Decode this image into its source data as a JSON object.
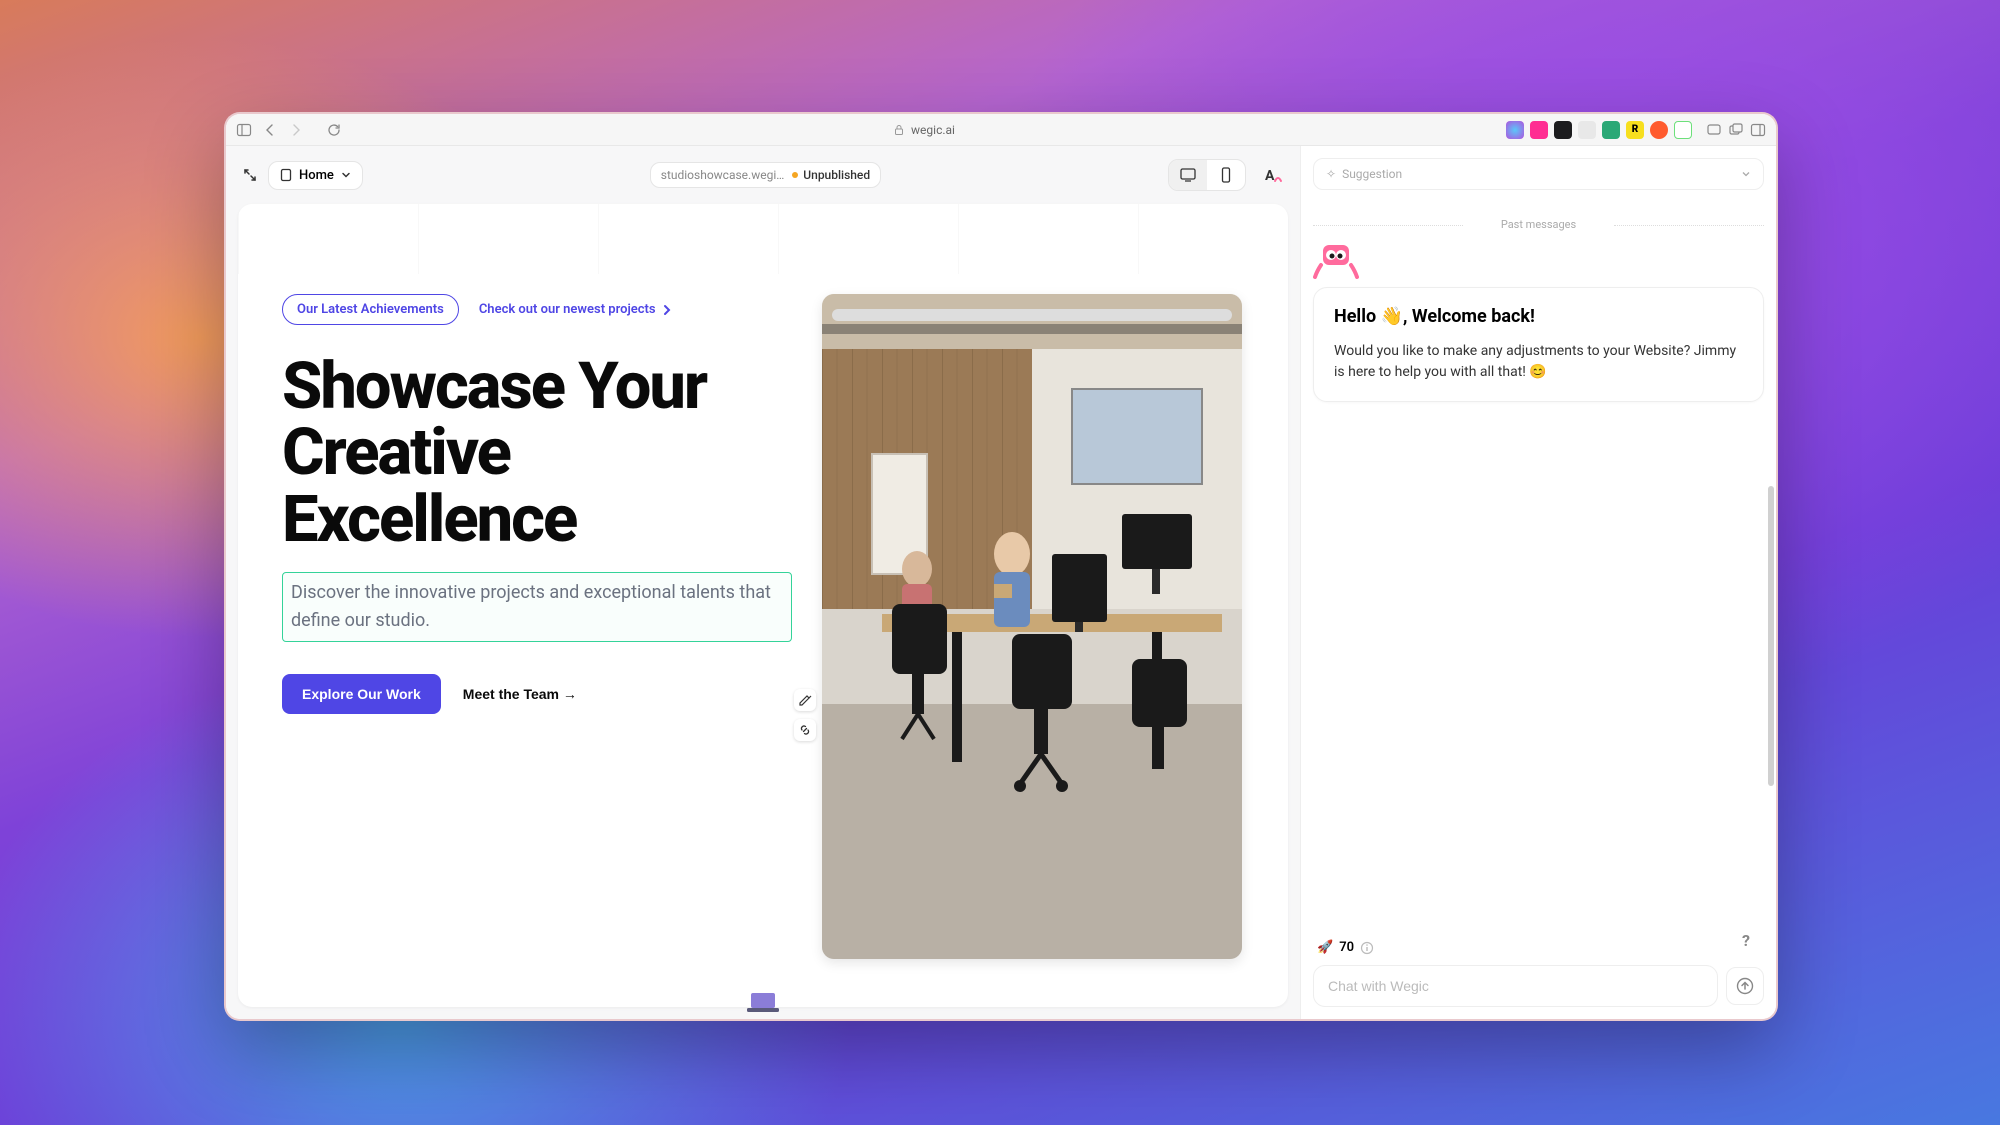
{
  "browser": {
    "url": "wegic.ai"
  },
  "editor": {
    "home_label": "Home",
    "project_url": "studioshowcase.wegi…",
    "status": "Unpublished"
  },
  "hero": {
    "badge": "Our Latest Achievements",
    "link": "Check out our newest projects",
    "title": "Showcase Your Creative Excellence",
    "description": "Discover the innovative projects and exceptional talents that define our studio.",
    "cta_primary": "Explore Our Work",
    "cta_secondary": "Meet the Team →"
  },
  "chat": {
    "suggestion_label": "Suggestion",
    "past_label": "Past messages",
    "greeting": "Hello 👋, Welcome back!",
    "body": "Would you like to make any adjustments to your Website? Jimmy is here to help you with all that! 😊",
    "credits": "70",
    "input_placeholder": "Chat with Wegic"
  },
  "colors": {
    "accent": "#4f46e5",
    "selection": "#34d399"
  }
}
